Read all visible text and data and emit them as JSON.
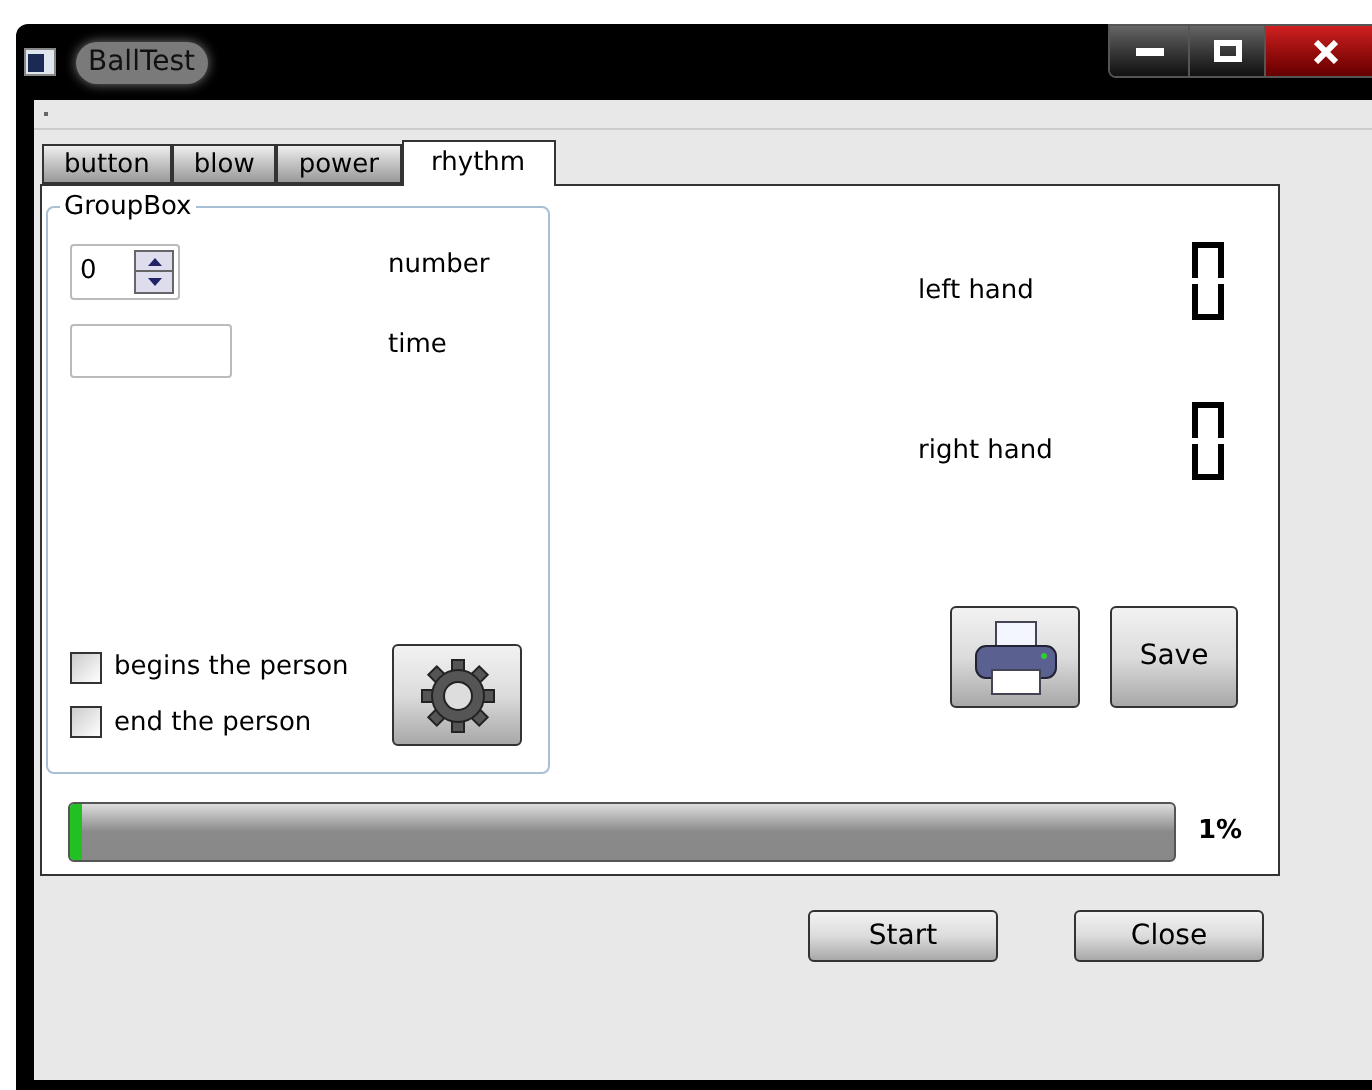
{
  "window": {
    "title": "BallTest"
  },
  "tabs": [
    {
      "label": "button",
      "selected": false
    },
    {
      "label": "blow",
      "selected": false
    },
    {
      "label": "power",
      "selected": false
    },
    {
      "label": "rhythm",
      "selected": true
    }
  ],
  "group_box": {
    "title": "GroupBox",
    "spin_value": "0",
    "number_label": "number",
    "time_label": "time",
    "checkboxes": [
      {
        "label": "begins the person",
        "checked": false
      },
      {
        "label": "end the person",
        "checked": false
      }
    ]
  },
  "hands": [
    {
      "label": "left hand"
    },
    {
      "label": "right hand"
    }
  ],
  "save_button": "Save",
  "progress": {
    "level": 0.01,
    "reading": "1%"
  },
  "buttons": [
    "Start",
    "Close"
  ]
}
